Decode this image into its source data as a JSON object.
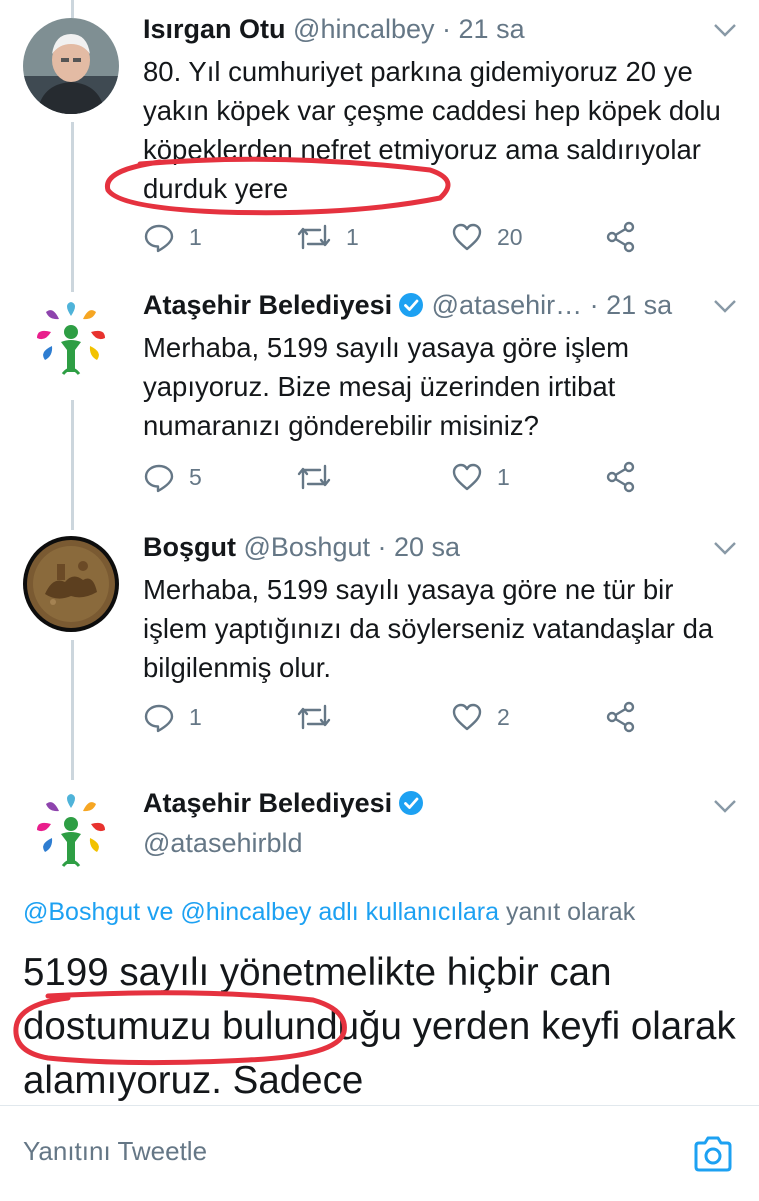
{
  "colors": {
    "accent": "#1da1f2",
    "secondary_text": "#657786",
    "primary_text": "#14171a",
    "annotation": "#e5323f"
  },
  "tweets": [
    {
      "name": "Isırgan Otu",
      "handle": "@hincalbey",
      "time": "· 21 sa",
      "text": "80. Yıl cumhuriyet parkına gidemiyoruz 20 ye yakın köpek var çeşme caddesi hep köpek dolu köpeklerden nefret etmiyoruz ama saldırıyolar durduk yere",
      "replies": "1",
      "retweets": "1",
      "likes": "20",
      "avatar_icon": "profile-photo"
    },
    {
      "name": "Ataşehir Belediyesi",
      "handle": "@atasehir…",
      "time": "· 21 sa",
      "text": "Merhaba, 5199 sayılı yasaya göre işlem yapıyoruz. Bize mesaj üzerinden irtibat numaranızı gönderebilir misiniz?",
      "replies": "5",
      "retweets": "",
      "likes": "1",
      "avatar_icon": "municipality-logo"
    },
    {
      "name": "Boşgut",
      "handle": "@Boshgut",
      "time": "· 20 sa",
      "text": "Merhaba, 5199 sayılı yasaya göre ne tür bir işlem yaptığınızı da söylerseniz vatandaşlar da bilgilenmiş olur.",
      "replies": "1",
      "retweets": "",
      "likes": "2",
      "avatar_icon": "coin-image"
    }
  ],
  "main_tweet": {
    "name": "Ataşehir Belediyesi",
    "handle": "@atasehirbld",
    "reply_prefix": "@Boshgut ve @hincalbey adlı kullanıcılara",
    "reply_suffix": " yanıt olarak",
    "text": "5199 sayılı yönetmelikte hiçbir can dostumuzu bulunduğu yerden keyfi olarak alamıyoruz. Sadece"
  },
  "compose": {
    "placeholder": "Yanıtını Tweetle",
    "camera_icon": "camera-icon"
  }
}
